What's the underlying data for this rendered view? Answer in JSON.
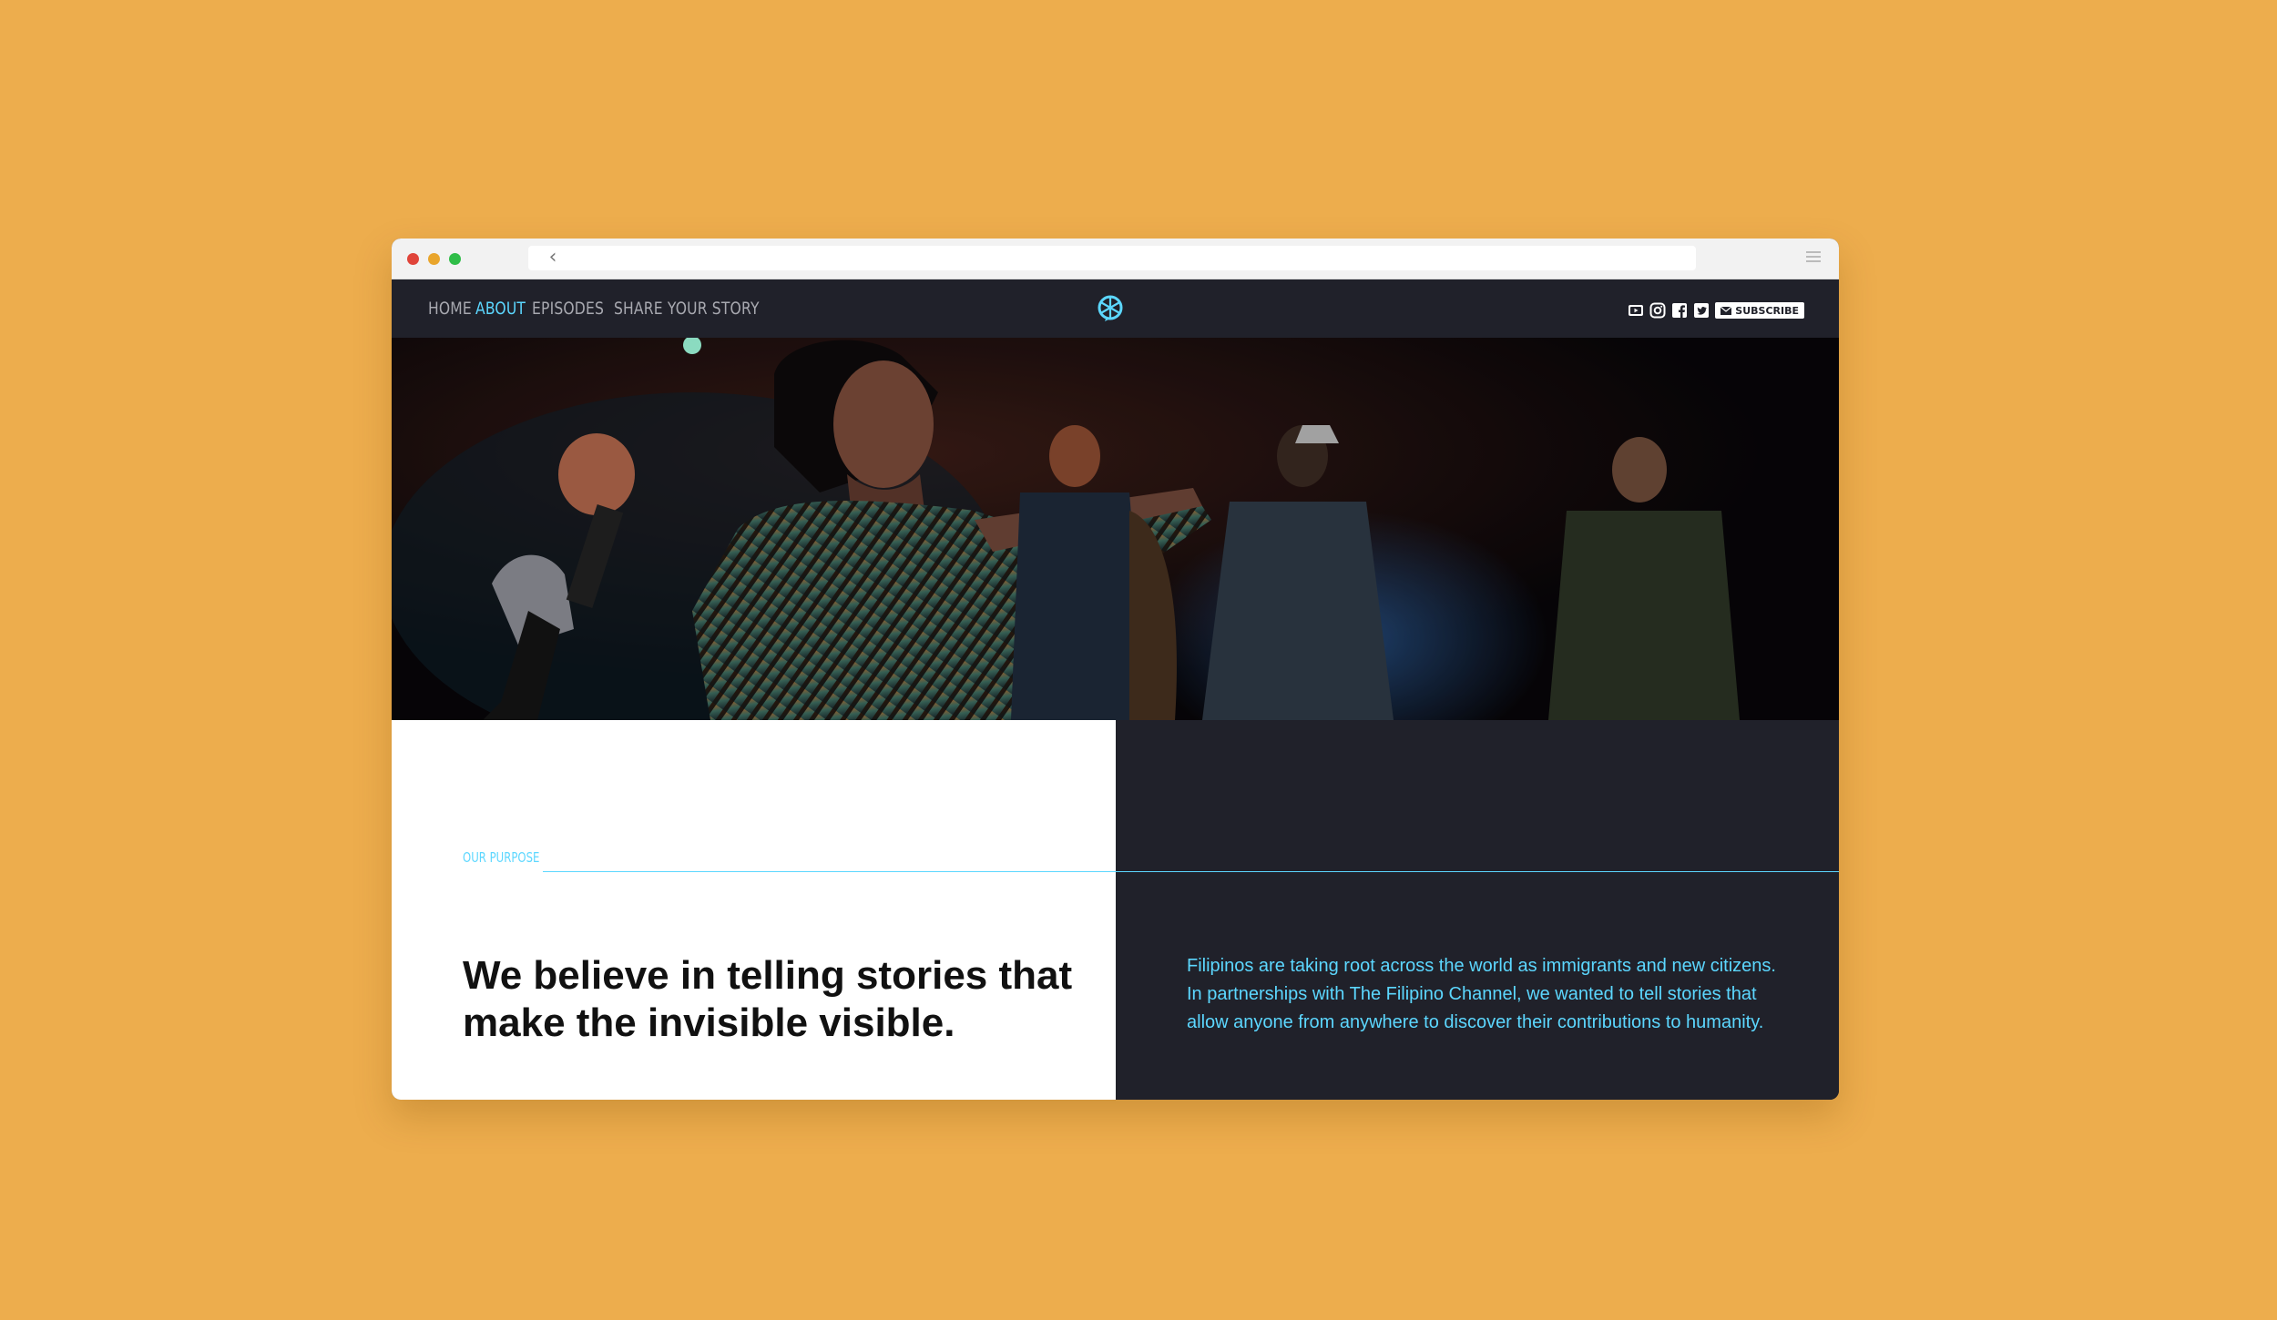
{
  "nav": {
    "links": [
      {
        "label": "HOME"
      },
      {
        "label": "ABOUT"
      },
      {
        "label": "EPISODES"
      },
      {
        "label": "SHARE YOUR STORY"
      }
    ],
    "social_icons": [
      "youtube-icon",
      "instagram-icon",
      "facebook-icon",
      "twitter-icon"
    ],
    "subscribe_label": "SUBSCRIBE"
  },
  "hero": {
    "image": "performer-with-microphone-on-stage-photo"
  },
  "purpose": {
    "label": "OUR PURPOSE",
    "headline": "We believe in telling stories that make the invisible visible.",
    "body": "Filipinos are taking root across the world as immigrants and new citizens. In partnerships with The Filipino Channel, we wanted to tell stories that allow anyone from anywhere to discover their contributions to humanity."
  },
  "colors": {
    "background": "#EDAD4D",
    "dark": "#20212a",
    "accent": "#5cd7ff"
  }
}
